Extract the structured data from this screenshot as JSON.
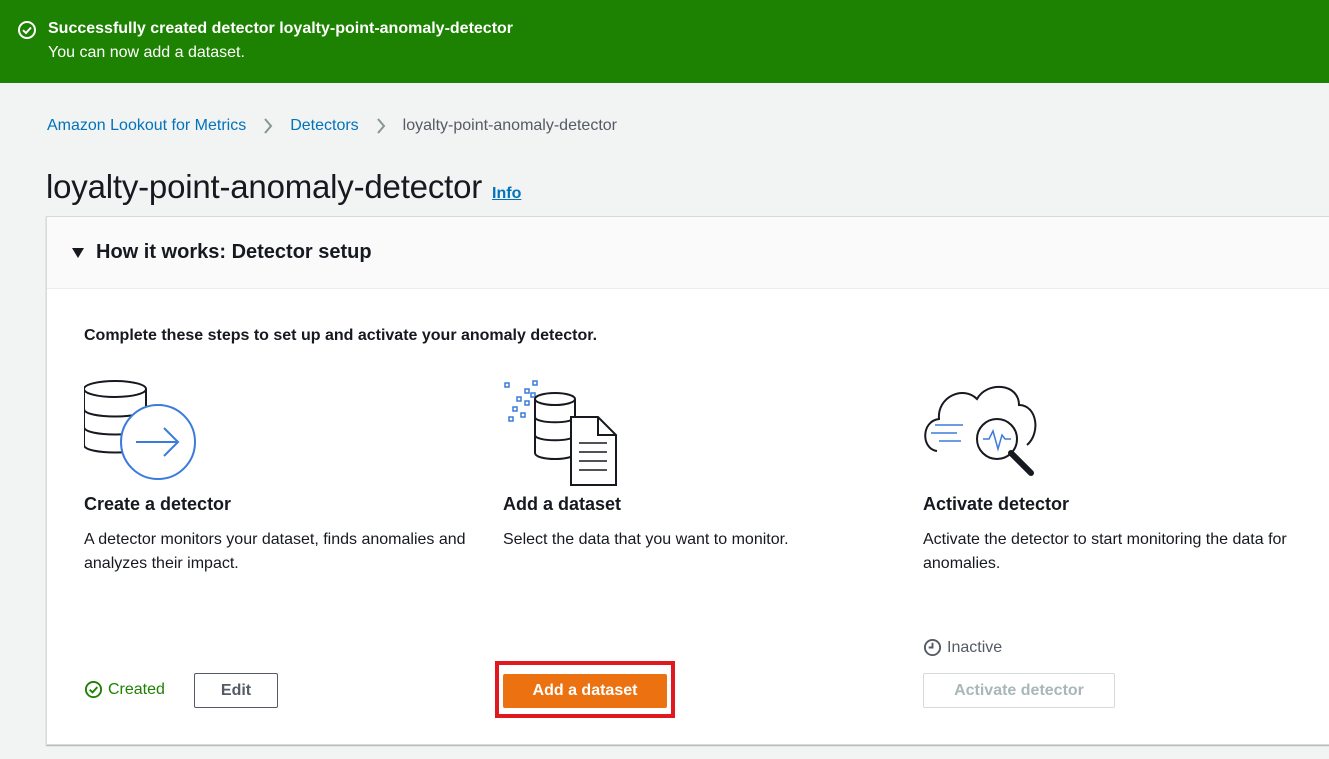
{
  "flash": {
    "title": "Successfully created detector loyalty-point-anomaly-detector",
    "message": "You can now add a dataset."
  },
  "breadcrumb": {
    "items": [
      "Amazon Lookout for Metrics",
      "Detectors"
    ],
    "current": "loyalty-point-anomaly-detector"
  },
  "page": {
    "title": "loyalty-point-anomaly-detector",
    "info_label": "Info"
  },
  "panel": {
    "header": "How it works: Detector setup",
    "intro": "Complete these steps to set up and activate your anomaly detector.",
    "steps": [
      {
        "title": "Create a detector",
        "description": "A detector monitors your dataset, finds anomalies and analyzes their impact.",
        "status": "Created",
        "button": "Edit",
        "icon": "database-arrow-icon"
      },
      {
        "title": "Add a dataset",
        "description": "Select the data that you want to monitor.",
        "button": "Add a dataset",
        "icon": "database-document-icon"
      },
      {
        "title": "Activate detector",
        "description": "Activate the detector to start monitoring the data for anomalies.",
        "status": "Inactive",
        "button": "Activate detector",
        "icon": "cloud-magnifier-icon"
      }
    ]
  },
  "colors": {
    "success": "#1d8102",
    "link": "#0073bb",
    "primary_button": "#ec7211",
    "highlight": "#e0191e",
    "accent_blue": "#3b7bdc"
  }
}
